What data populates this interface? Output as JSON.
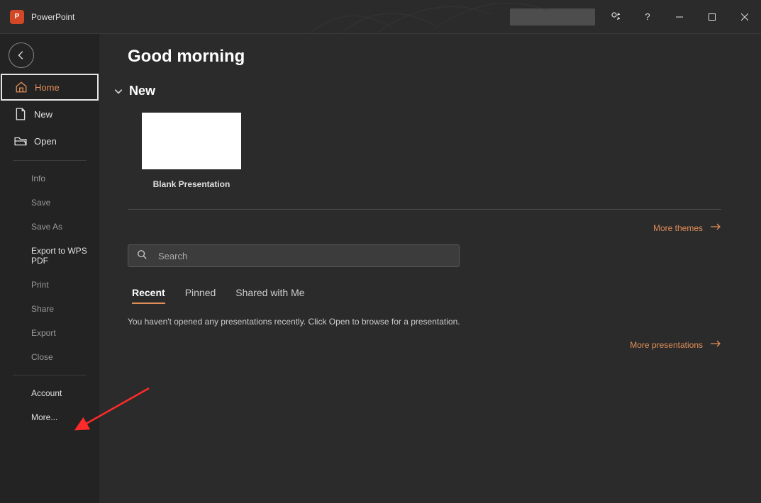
{
  "app": {
    "title": "PowerPoint",
    "logo_letter": "P"
  },
  "sidebar": {
    "home": "Home",
    "new": "New",
    "open": "Open",
    "info": "Info",
    "save": "Save",
    "save_as": "Save As",
    "export_wps": "Export to WPS PDF",
    "print": "Print",
    "share": "Share",
    "export": "Export",
    "close": "Close",
    "account": "Account",
    "more": "More..."
  },
  "content": {
    "greeting": "Good morning",
    "new_section": "New",
    "blank_presentation": "Blank Presentation",
    "more_themes": "More themes",
    "search_placeholder": "Search",
    "tabs": {
      "recent": "Recent",
      "pinned": "Pinned",
      "shared": "Shared with Me"
    },
    "empty_recent": "You haven't opened any presentations recently. Click Open to browse for a presentation.",
    "more_presentations": "More presentations"
  },
  "colors": {
    "accent": "#e08e57",
    "brand": "#d24726"
  }
}
